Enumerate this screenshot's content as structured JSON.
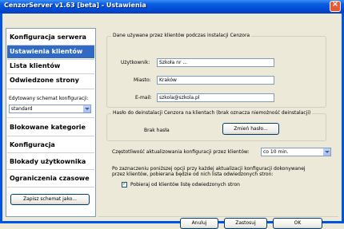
{
  "window": {
    "title": "CenzorServer v1.63 [beta] - Ustawienia",
    "close_glyph": "×"
  },
  "sidebar": {
    "top_items": [
      {
        "label": "Konfiguracja serwera",
        "selected": false
      },
      {
        "label": "Ustawienia klientów",
        "selected": true
      },
      {
        "label": "Lista klientów",
        "selected": false
      },
      {
        "label": "Odwiedzone strony",
        "selected": false
      }
    ],
    "schema_label": "Edytowany schemat konfiguracji:",
    "schema_value": "standard",
    "bottom_items": [
      {
        "label": "Blokowane kategorie"
      },
      {
        "label": "Konfiguracja"
      },
      {
        "label": "Blokady użytkownika"
      },
      {
        "label": "Ograniczenia czasowe"
      }
    ],
    "save_schema_button": "Zapisz schemat jako..."
  },
  "install_data": {
    "group_label": "Dane używane przez klientów podczas instalacji Cenzora",
    "user_label": "Użytkownik:",
    "user_value": "Szkoła nr ...",
    "city_label": "Miasto:",
    "city_value": "Kraków",
    "email_label": "E-mail:",
    "email_value": "szkola@szkola.pl"
  },
  "uninstall_password": {
    "group_label": "Hasło do deinstalacji Cenzora na klientach (brak oznacza niemożność deinstalacji)",
    "status": "Brak hasła",
    "change_button": "Zmień hasło..."
  },
  "update_frequency": {
    "label": "Częstotliwość aktualizowania konfiguracji przez klientów:",
    "value": "co 10 min."
  },
  "sites_option": {
    "description_line1": "Po zaznaczeniu poniższej opcji przy każdej aktualizacji konfiguracji dokonywanej",
    "description_line2": "przez klientów, pobierana będzie od nich lista odwiedzonych stron:",
    "checkbox_label": "Pobieraj od klientów listę odwiedzonych stron",
    "checked": true
  },
  "footer": {
    "cancel": "Anuluj",
    "apply": "Zastosuj",
    "ok": "OK"
  }
}
